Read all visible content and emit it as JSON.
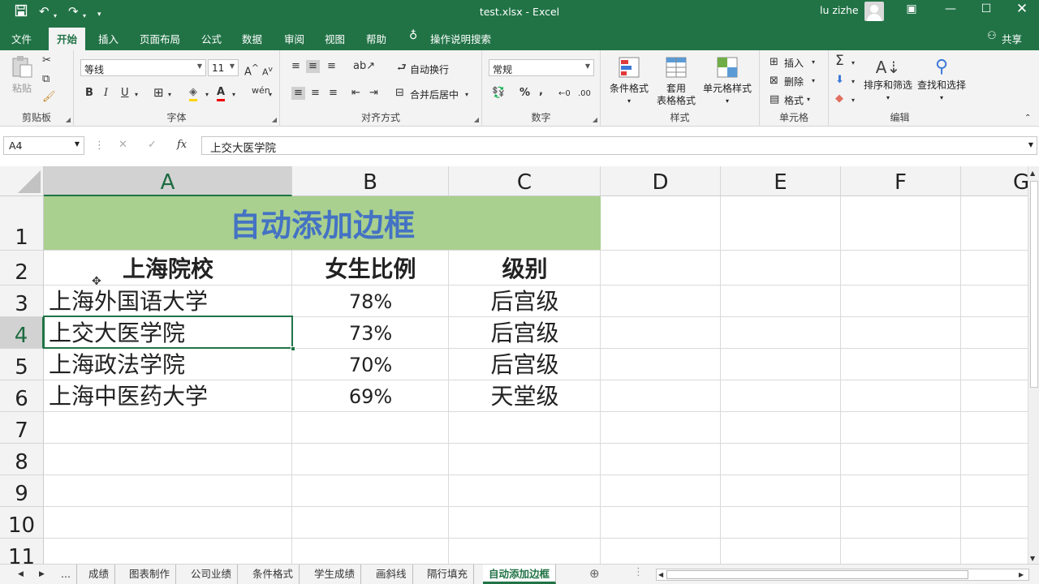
{
  "app": {
    "file_title": "test.xlsx  -  Excel",
    "user": "lu zizhe"
  },
  "tabs": [
    "文件",
    "开始",
    "插入",
    "页面布局",
    "公式",
    "数据",
    "审阅",
    "视图",
    "帮助"
  ],
  "tell_me": "操作说明搜索",
  "share": "共享",
  "ribbon": {
    "clipboard": {
      "label": "剪贴板",
      "paste": "粘贴"
    },
    "font": {
      "label": "字体",
      "name": "等线",
      "size": "11",
      "bold": "B",
      "italic": "I",
      "underline": "U"
    },
    "alignment": {
      "label": "对齐方式",
      "wrap": "自动换行",
      "merge": "合并后居中"
    },
    "number": {
      "label": "数字",
      "format": "常规"
    },
    "styles": {
      "label": "样式",
      "conditional": "条件格式",
      "table1": "套用",
      "table2": "表格格式",
      "cell_styles": "单元格样式"
    },
    "cells": {
      "label": "单元格",
      "insert": "插入",
      "delete": "删除",
      "format": "格式"
    },
    "editing": {
      "label": "编辑",
      "sort": "排序和筛选",
      "find": "查找和选择"
    }
  },
  "formula_bar": {
    "name_box": "A4",
    "content": "上交大医学院"
  },
  "columns": [
    "A",
    "B",
    "C",
    "D",
    "E",
    "F",
    "G"
  ],
  "rows": [
    "1",
    "2",
    "3",
    "4",
    "5",
    "6",
    "7",
    "8",
    "9",
    "10",
    "11"
  ],
  "sheet": {
    "title": "自动添加边框",
    "headers": [
      "上海院校",
      "女生比例",
      "级别"
    ],
    "data": [
      [
        "上海外国语大学",
        "78%",
        "后宫级"
      ],
      [
        "上交大医学院",
        "73%",
        "后宫级"
      ],
      [
        "上海政法学院",
        "70%",
        "后宫级"
      ],
      [
        "上海中医药大学",
        "69%",
        "天堂级"
      ]
    ]
  },
  "sheet_tabs": [
    "...",
    "成绩",
    "图表制作",
    "公司业绩",
    "条件格式",
    "学生成绩",
    "画斜线",
    "隔行填充",
    "自动添加边框"
  ],
  "colors": {
    "accent": "#217346",
    "title_fill": "#a9d08e",
    "title_text": "#4472c4"
  }
}
